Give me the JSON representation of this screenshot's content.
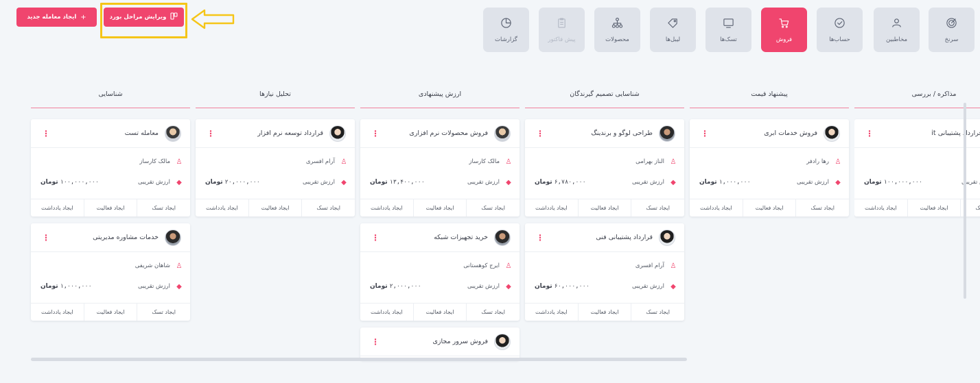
{
  "toolbar": {
    "create_deal_label": "ایجاد معامله جدید",
    "create_deal_icon": "plus-icon",
    "edit_stages_label": "ویرایش مراحل بورد",
    "edit_stages_icon": "board-columns-icon"
  },
  "nav": {
    "items": [
      {
        "label": "سرنخ",
        "icon": "target-icon",
        "state": "normal"
      },
      {
        "label": "مخاطبین",
        "icon": "contacts-icon",
        "state": "normal"
      },
      {
        "label": "حساب‌ها",
        "icon": "check-circle-icon",
        "state": "normal"
      },
      {
        "label": "فروش",
        "icon": "cart-icon",
        "state": "active"
      },
      {
        "label": "تسک‌ها",
        "icon": "monitor-icon",
        "state": "normal"
      },
      {
        "label": "لیبل‌ها",
        "icon": "tag-icon",
        "state": "normal"
      },
      {
        "label": "محصولات",
        "icon": "hierarchy-icon",
        "state": "normal"
      },
      {
        "label": "پیش فاکتور",
        "icon": "clipboard-icon",
        "state": "disabled"
      },
      {
        "label": "گزارشات",
        "icon": "pie-chart-icon",
        "state": "normal"
      }
    ]
  },
  "labels": {
    "amount_label": "ارزش تقریبی",
    "currency": "تومان",
    "create_task": "ایجاد تسک",
    "create_activity": "ایجاد فعالیت",
    "create_note": "ایجاد یادداشت"
  },
  "board": {
    "columns": [
      {
        "title": "شناسایی",
        "cards": [
          {
            "title": "معامله تست",
            "owner": "مالک کارساز",
            "amount": "۱۰۰,۰۰۰,۰۰۰",
            "avatar": "a1"
          },
          {
            "title": "خدمات مشاوره مدیریتی",
            "owner": "شاهان شریفی",
            "amount": "۱,۰۰۰,۰۰۰",
            "avatar": "a3"
          }
        ]
      },
      {
        "title": "تحلیل نیازها",
        "cards": [
          {
            "title": "قرارداد توسعه نرم افزار",
            "owner": "آرام افسری",
            "amount": "۲۰,۰۰۰,۰۰۰",
            "avatar": "a2"
          }
        ]
      },
      {
        "title": "ارزش پیشنهادی",
        "cards": [
          {
            "title": "فروش محصولات نرم افزاری",
            "owner": "مالک کارساز",
            "amount": "۱۳,۴۰۰,۰۰۰",
            "avatar": "a1"
          },
          {
            "title": "خرید تجهیزات شبکه",
            "owner": "ایرج کوهستانی",
            "amount": "۲,۰۰۰,۰۰۰",
            "avatar": "a3"
          },
          {
            "title": "فروش سرور مجازی",
            "short": true,
            "avatar": "a2"
          }
        ]
      },
      {
        "title": "شناسایی تصمیم گیرندگان",
        "cards": [
          {
            "title": "طراحی لوگو و برندینگ",
            "owner": "الناز بهرامی",
            "amount": "۶,۷۸۰,۰۰۰",
            "avatar": "a3"
          },
          {
            "title": "قرارداد پشتیبانی فنی",
            "owner": "آرام افسری",
            "amount": "۶۰,۰۰۰,۰۰۰",
            "avatar": "a2"
          }
        ]
      },
      {
        "title": "پیشنهاد قیمت",
        "cards": [
          {
            "title": "فروش خدمات ابری",
            "owner": "رها رادفر",
            "amount": "۱,۰۰۰,۰۰۰",
            "avatar": "a2"
          }
        ]
      },
      {
        "title": "مذاکره / بررسی",
        "cards": [
          {
            "title": "قرارداد پشتیبانی it",
            "owner": "",
            "amount": "۱۰۰,۰۰۰,۰۰۰",
            "avatar": "a1"
          }
        ]
      }
    ]
  },
  "colors": {
    "accent": "#f0456e",
    "highlight": "#f5c518",
    "background": "#f3f6f9",
    "tile": "#dfe3ea"
  }
}
